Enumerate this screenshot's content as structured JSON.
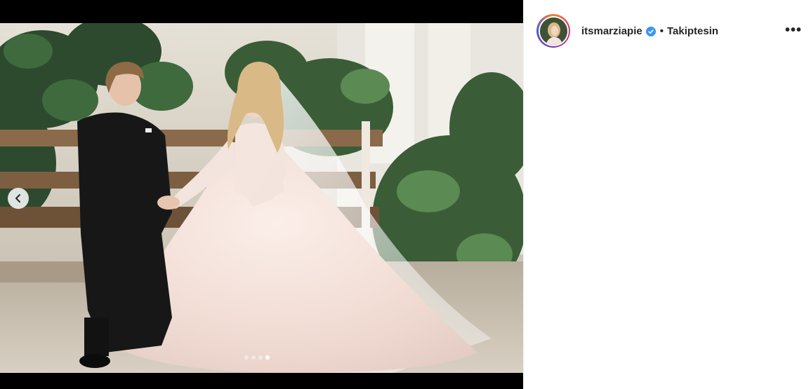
{
  "post": {
    "username": "itsmarziapie",
    "separator": "•",
    "follow_status": "Takiptesin",
    "more_label": "•••",
    "verified_icon": "verified-badge-icon",
    "carousel": {
      "total_slides": 4,
      "active_slide": 4
    }
  },
  "colors": {
    "verified": "#3897f0",
    "text": "#262626"
  }
}
